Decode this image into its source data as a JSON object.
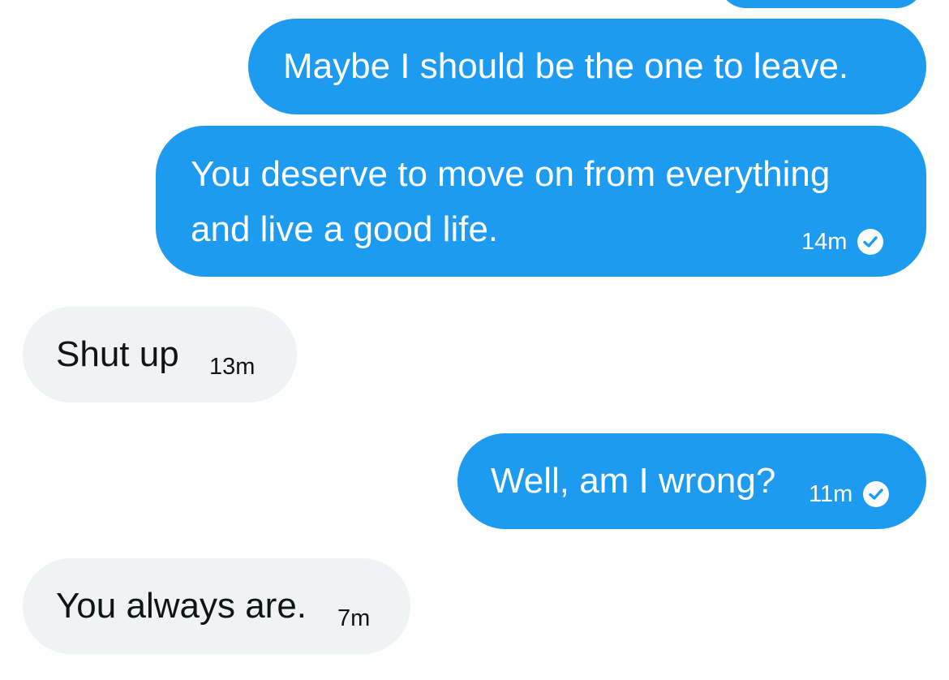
{
  "colors": {
    "sent_bubble": "#1d9bf0",
    "received_bubble": "#eff3f4",
    "sent_text": "#ffffff",
    "received_text": "#0f1419"
  },
  "messages": [
    {
      "direction": "sent",
      "text": "Maybe I should be the one to leave.",
      "time": "",
      "read_icon": ""
    },
    {
      "direction": "sent",
      "text_line1": "You deserve to move on from everything",
      "text_line2": "and live a good life.",
      "time": "14m",
      "read_icon": "check-circle-icon"
    },
    {
      "direction": "received",
      "text": "Shut up",
      "time": "13m"
    },
    {
      "direction": "sent",
      "text": "Well, am I wrong?",
      "time": "11m",
      "read_icon": "check-circle-icon"
    },
    {
      "direction": "received",
      "text": "You always are.",
      "time": "7m"
    }
  ]
}
